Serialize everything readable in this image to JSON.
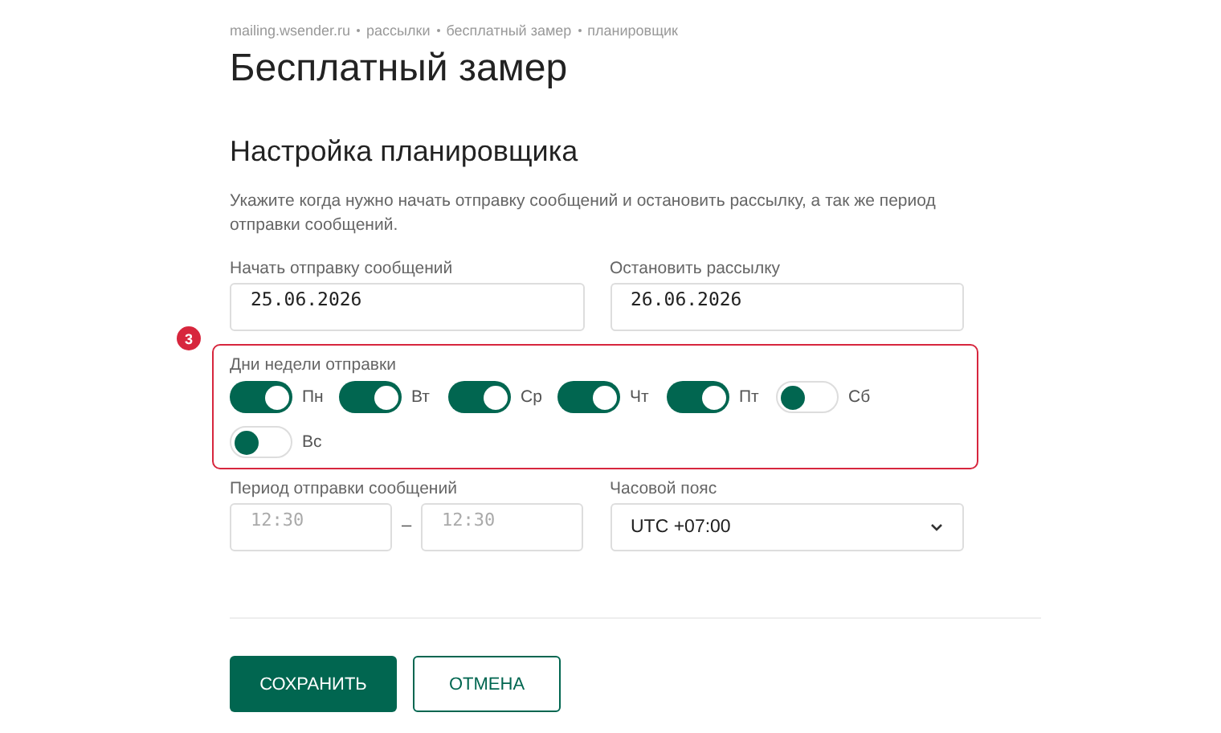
{
  "breadcrumbs": [
    "mailing.wsender.ru",
    "рассылки",
    "бесплатный замер",
    "планировщик"
  ],
  "title": "Бесплатный замер",
  "section_title": "Настройка планировщика",
  "description": "Укажите когда нужно начать отправку сообщений и остановить рассылку, а так же период отправки сообщений.",
  "start_date": {
    "label": "Начать отправку сообщений",
    "value": "25.06.2026"
  },
  "stop_date": {
    "label": "Остановить рассылку",
    "value": "26.06.2026"
  },
  "highlight": {
    "badge": "3"
  },
  "weekdays": {
    "label": "Дни недели отправки",
    "days": [
      {
        "label": "Пн",
        "on": true
      },
      {
        "label": "Вт",
        "on": true
      },
      {
        "label": "Ср",
        "on": true
      },
      {
        "label": "Чт",
        "on": true
      },
      {
        "label": "Пт",
        "on": true
      },
      {
        "label": "Сб",
        "on": false
      },
      {
        "label": "Вс",
        "on": false
      }
    ]
  },
  "period": {
    "label": "Период отправки сообщений",
    "from": {
      "placeholder": "12:30"
    },
    "separator": "–",
    "to": {
      "placeholder": "12:30"
    }
  },
  "timezone": {
    "label": "Часовой пояс",
    "value": "UTC +07:00"
  },
  "buttons": [
    {
      "label": "СОХРАНИТЬ",
      "kind": "primary"
    },
    {
      "label": "ОТМЕНА",
      "kind": "secondary"
    }
  ]
}
